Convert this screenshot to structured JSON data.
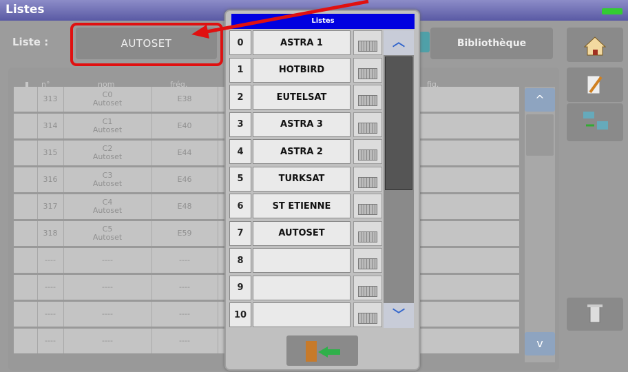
{
  "window": {
    "title": "Listes"
  },
  "top": {
    "liste_label": "Liste :",
    "current_list": "AUTOSET",
    "library_label": "Bibliothèque"
  },
  "table": {
    "headers": [
      "n°",
      "nom",
      "fréq.",
      "fig."
    ],
    "rows": [
      {
        "n": "313",
        "name_top": "C0",
        "name_bottom": "Autoset",
        "freq": "E38"
      },
      {
        "n": "314",
        "name_top": "C1",
        "name_bottom": "Autoset",
        "freq": "E40"
      },
      {
        "n": "315",
        "name_top": "C2",
        "name_bottom": "Autoset",
        "freq": "E44"
      },
      {
        "n": "316",
        "name_top": "C3",
        "name_bottom": "Autoset",
        "freq": "E46"
      },
      {
        "n": "317",
        "name_top": "C4",
        "name_bottom": "Autoset",
        "freq": "E48"
      },
      {
        "n": "318",
        "name_top": "C5",
        "name_bottom": "Autoset",
        "freq": "E59"
      },
      {
        "n": "----",
        "name_top": "",
        "name_bottom": "----",
        "freq": "----"
      },
      {
        "n": "----",
        "name_top": "",
        "name_bottom": "----",
        "freq": "----"
      },
      {
        "n": "----",
        "name_top": "",
        "name_bottom": "----",
        "freq": "----"
      },
      {
        "n": "----",
        "name_top": "",
        "name_bottom": "----",
        "freq": "----"
      }
    ]
  },
  "popup": {
    "title": "Listes",
    "items": [
      {
        "num": "0",
        "name": "ASTRA 1"
      },
      {
        "num": "1",
        "name": "HOTBIRD"
      },
      {
        "num": "2",
        "name": "EUTELSAT"
      },
      {
        "num": "3",
        "name": "ASTRA 3"
      },
      {
        "num": "4",
        "name": "ASTRA 2"
      },
      {
        "num": "5",
        "name": "TURKSAT"
      },
      {
        "num": "6",
        "name": "ST ETIENNE"
      },
      {
        "num": "7",
        "name": "AUTOSET"
      },
      {
        "num": "8",
        "name": ""
      },
      {
        "num": "9",
        "name": ""
      },
      {
        "num": "10",
        "name": ""
      }
    ]
  },
  "colors": {
    "annotation": "#e01010",
    "title_bar": "#6a6ab4",
    "popup_title": "#0000e0"
  },
  "icons": [
    "home-icon",
    "edit-icon",
    "transfer-icon",
    "trash-icon",
    "keyboard-icon",
    "exit-door-icon",
    "scroll-up-icon",
    "scroll-down-icon",
    "library-icon"
  ]
}
